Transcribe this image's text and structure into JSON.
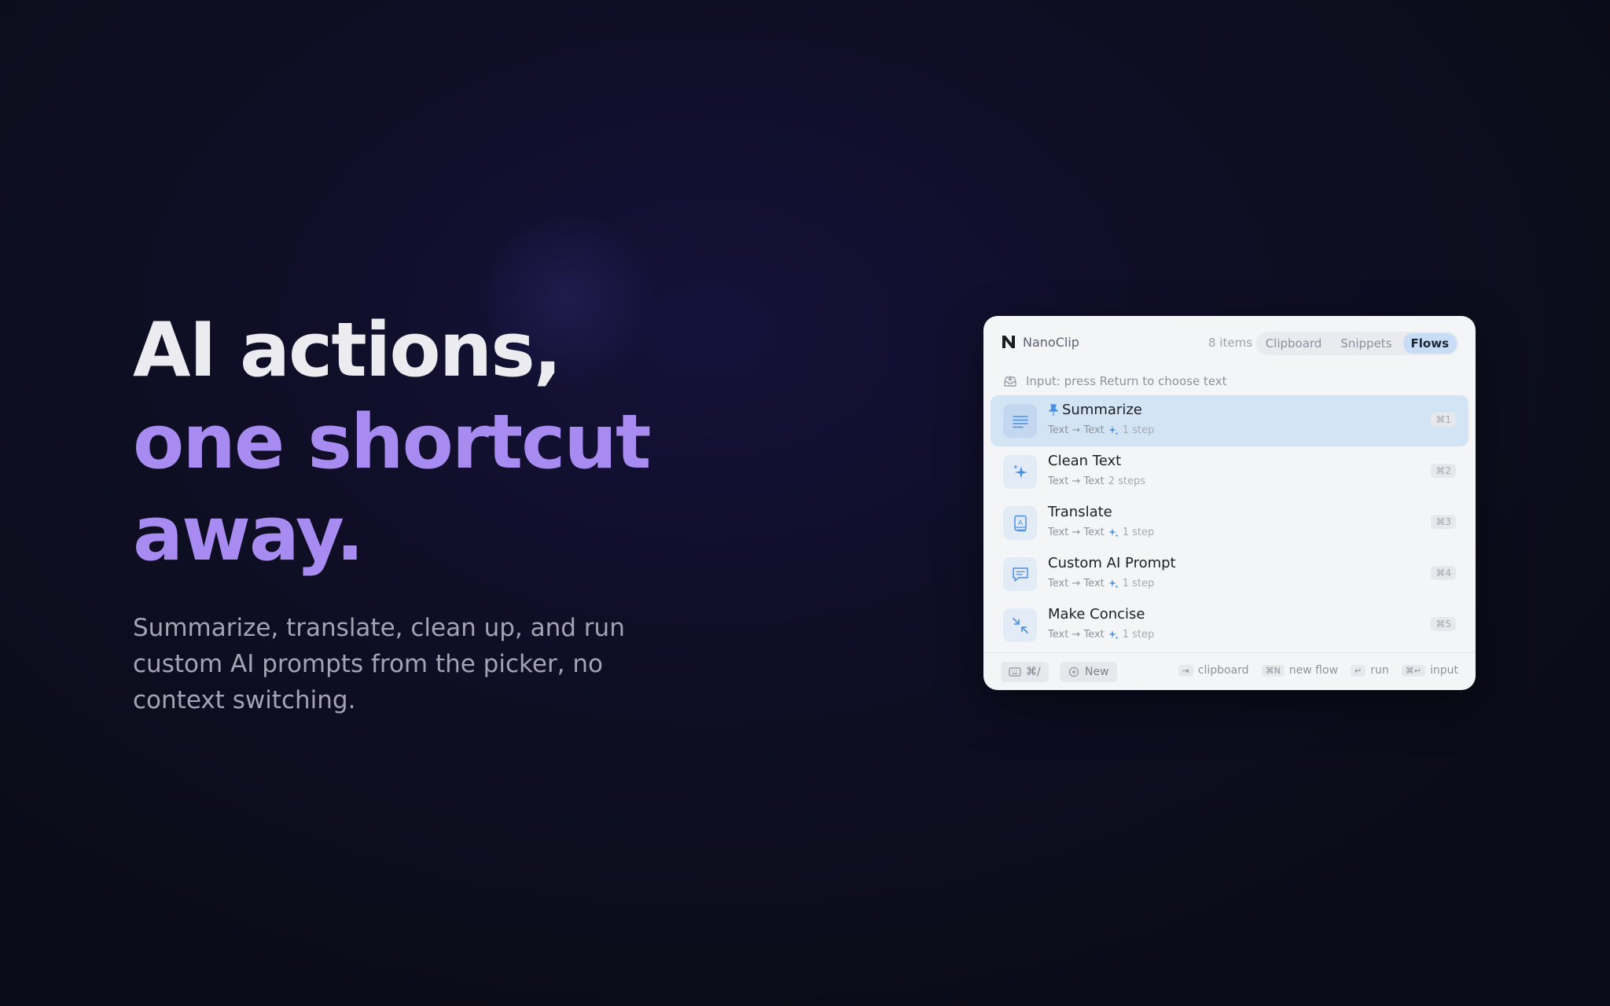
{
  "hero": {
    "line1": "AI actions,",
    "line2": "one shortcut",
    "line3": "away.",
    "subtitle": "Summarize, translate, clean up, and run custom AI prompts from the picker, no context switching."
  },
  "picker": {
    "brand": "NanoClip",
    "count": "8 items",
    "tabs": [
      {
        "label": "Clipboard",
        "active": false
      },
      {
        "label": "Snippets",
        "active": false
      },
      {
        "label": "Flows",
        "active": true
      }
    ],
    "input_hint": "Input: press Return to choose text",
    "flows": [
      {
        "title": "Summarize",
        "io": "Text → Text",
        "steps": "1 step",
        "shortcut": "⌘1",
        "icon": "lines-icon",
        "pinned": true,
        "selected": true
      },
      {
        "title": "Clean Text",
        "io": "Text → Text",
        "steps": "2 steps",
        "shortcut": "⌘2",
        "icon": "sparkles-icon",
        "pinned": false,
        "selected": false
      },
      {
        "title": "Translate",
        "io": "Text → Text",
        "steps": "1 step",
        "shortcut": "⌘3",
        "icon": "dictionary-icon",
        "pinned": false,
        "selected": false
      },
      {
        "title": "Custom AI Prompt",
        "io": "Text → Text",
        "steps": "1 step",
        "shortcut": "⌘4",
        "icon": "chat-bubble-icon",
        "pinned": false,
        "selected": false
      },
      {
        "title": "Make Concise",
        "io": "Text → Text",
        "steps": "1 step",
        "shortcut": "⌘5",
        "icon": "arrows-compress-icon",
        "pinned": false,
        "selected": false
      }
    ],
    "footer": {
      "keyboard_button": "⌘/",
      "new_button": "New",
      "hints": [
        {
          "key": "⇥",
          "label": "clipboard"
        },
        {
          "key": "⌘N",
          "label": "new flow"
        },
        {
          "key": "↵",
          "label": "run"
        },
        {
          "key": "⌘↵",
          "label": "input"
        }
      ]
    },
    "colors": {
      "accent": "#4a90e2",
      "selected_row": "#d3e4f5",
      "headline_purple": "#a88bf0"
    }
  }
}
